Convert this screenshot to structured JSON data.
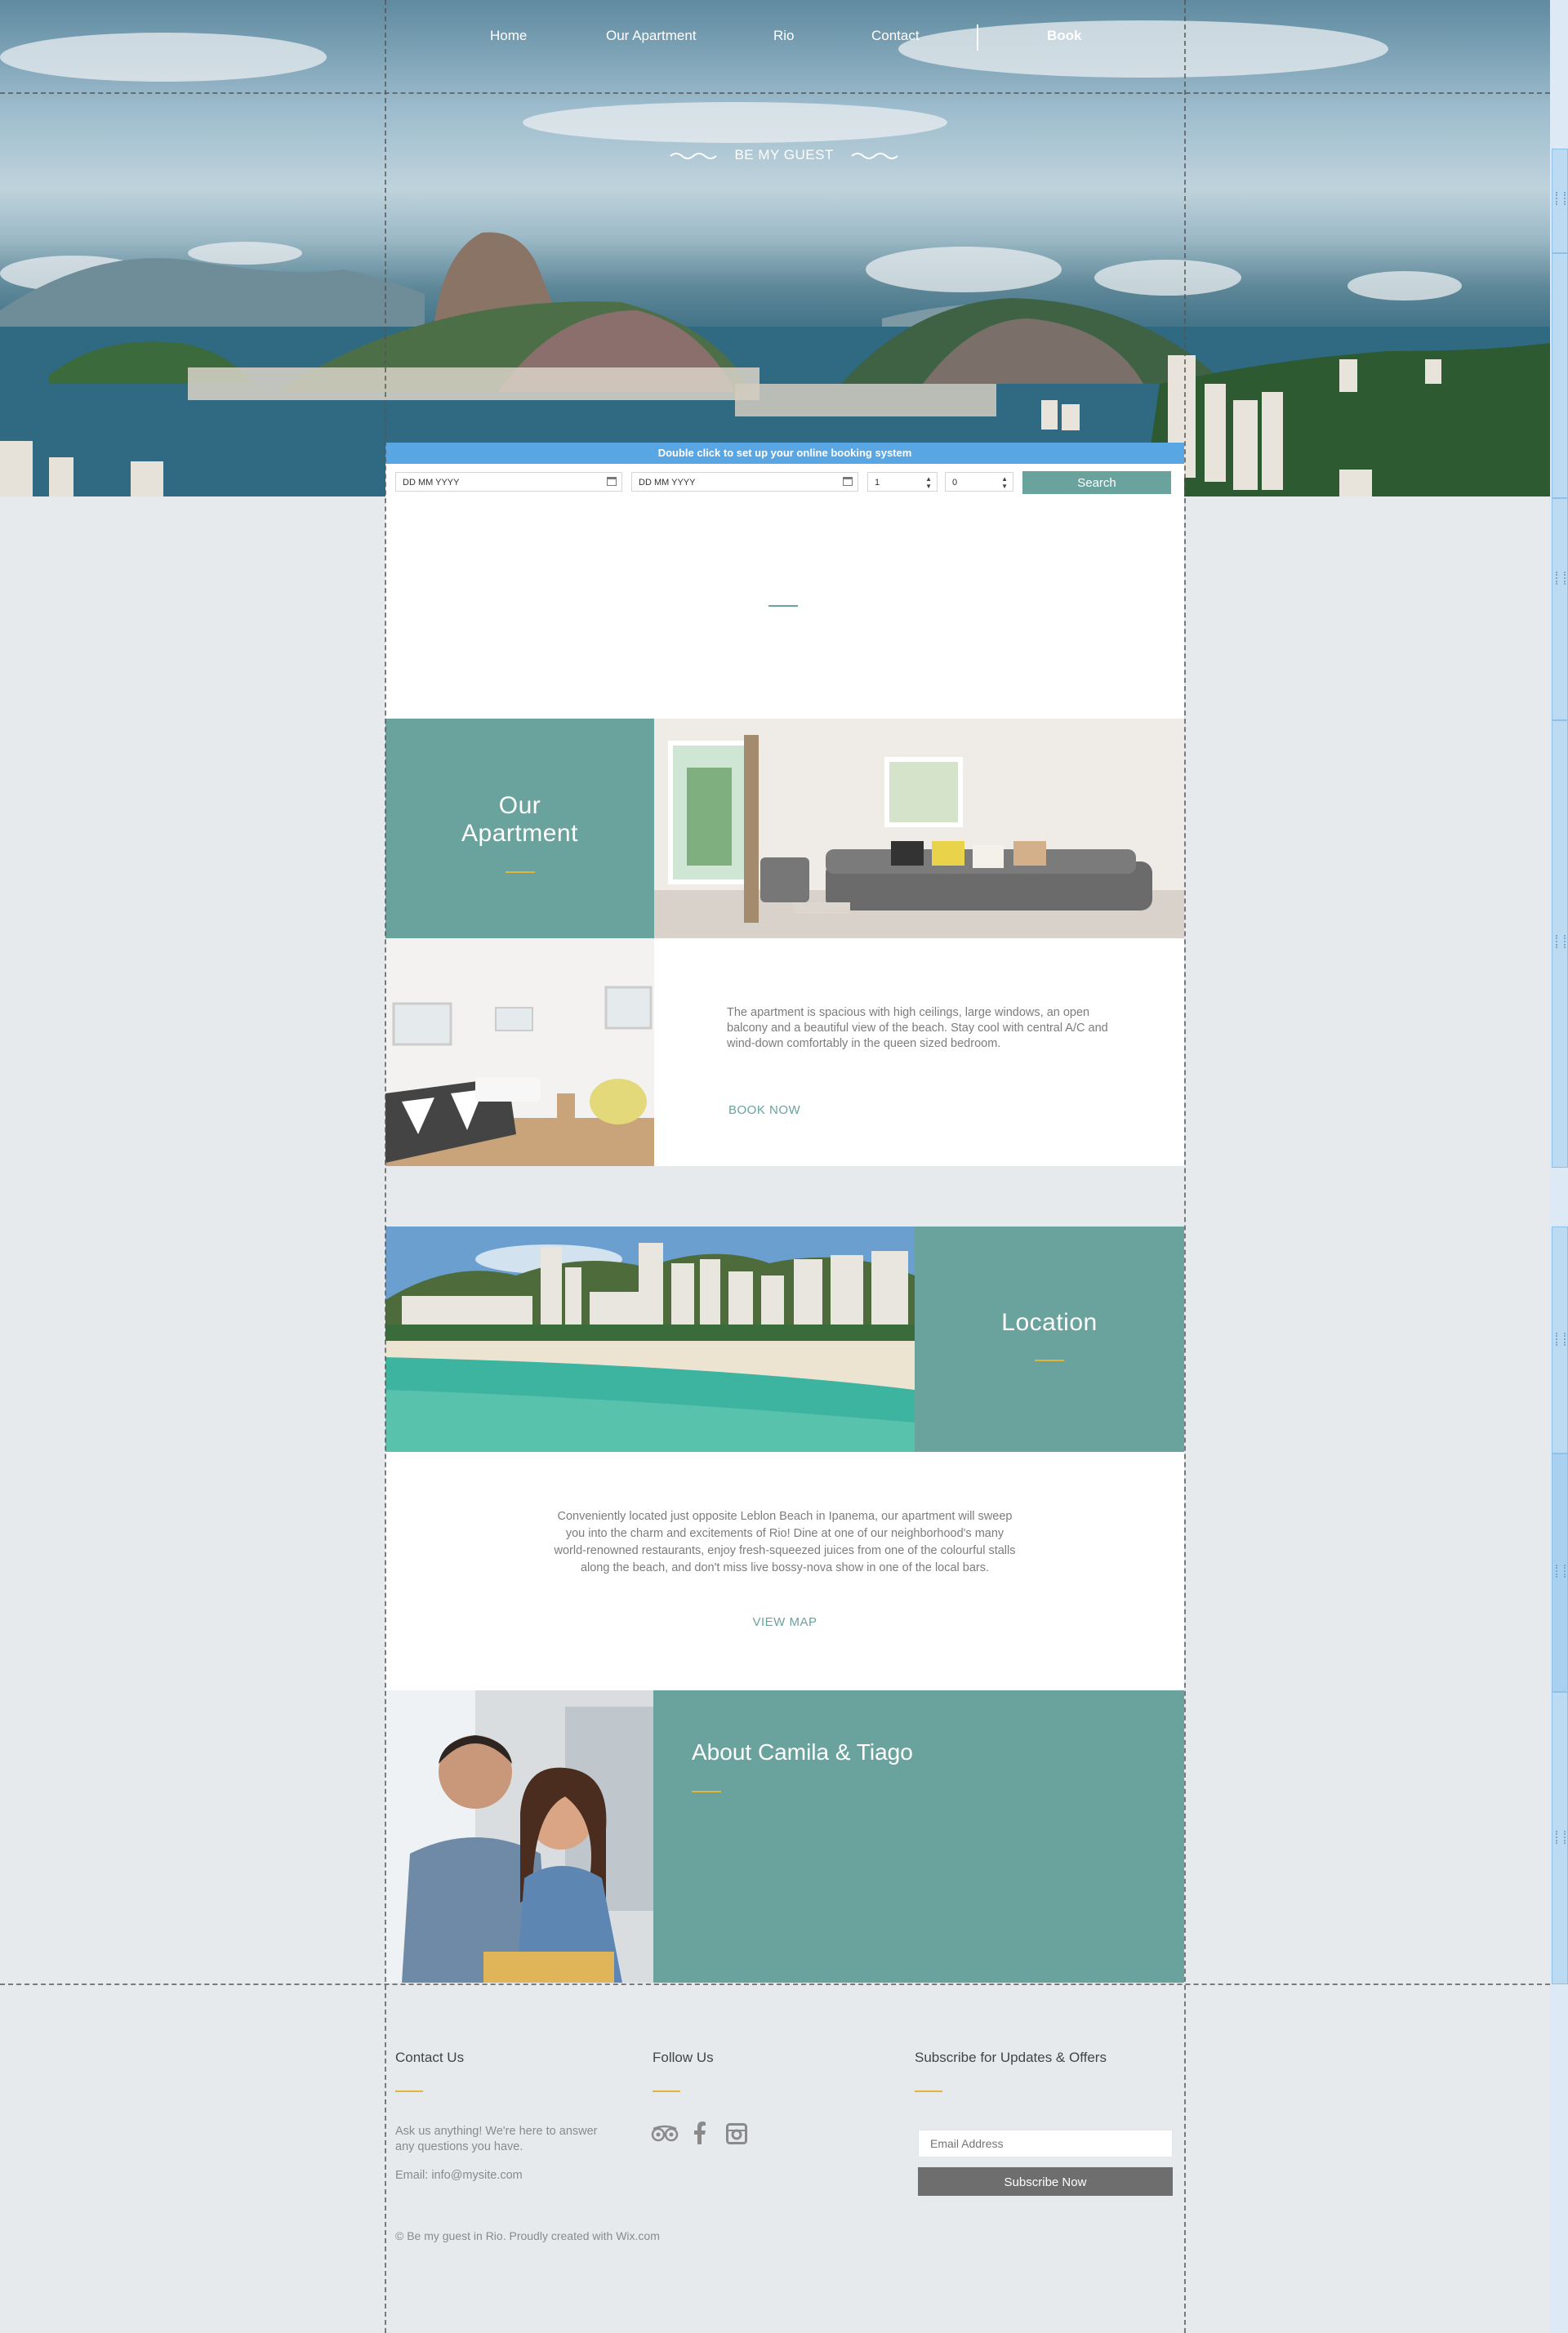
{
  "nav": {
    "items": [
      {
        "label": "Home"
      },
      {
        "label": "Our Apartment"
      },
      {
        "label": "Rio"
      },
      {
        "label": "Contact"
      }
    ],
    "book_label": "Book"
  },
  "hero": {
    "tagline": "BE MY GUEST"
  },
  "booking": {
    "notice": "Double click to set up your online booking system",
    "checkin_placeholder": "DD MM YYYY",
    "checkout_placeholder": "DD MM YYYY",
    "adults": "1",
    "children": "0",
    "search_label": "Search"
  },
  "apartment": {
    "title_line1": "Our",
    "title_line2": "Apartment",
    "description": "The apartment is spacious with high ceilings, large windows, an open balcony and a beautiful view of the beach. Stay cool with central A/C and wind-down comfortably in the queen sized bedroom.",
    "cta": "BOOK NOW"
  },
  "location": {
    "title": "Location",
    "description": "Conveniently located just opposite Leblon Beach in Ipanema, our apartment will sweep you into the charm and excitements of Rio! Dine at one of our neighborhood's many world-renowned restaurants, enjoy fresh-squeezed juices from one of the colourful stalls along the beach, and don't miss live bossy-nova show in one of the local bars.",
    "cta": "VIEW MAP"
  },
  "about": {
    "title": "About Camila & Tiago"
  },
  "footer": {
    "contact": {
      "heading": "Contact Us",
      "text": "Ask us anything! We're here to answer any questions you have.",
      "email": "Email: info@mysite.com"
    },
    "follow": {
      "heading": "Follow Us",
      "icons": [
        "tripadvisor-icon",
        "facebook-icon",
        "instagram-icon"
      ]
    },
    "subscribe": {
      "heading": "Subscribe for Updates & Offers",
      "email_placeholder": "Email Address",
      "button_label": "Subscribe Now"
    },
    "copyright": "© Be my guest in Rio. Proudly created with Wix.com"
  },
  "colors": {
    "teal": "#6aa29d",
    "gold": "#e0b53a",
    "page_bg": "#e6eaed",
    "booking_blue": "#59a6e4"
  }
}
